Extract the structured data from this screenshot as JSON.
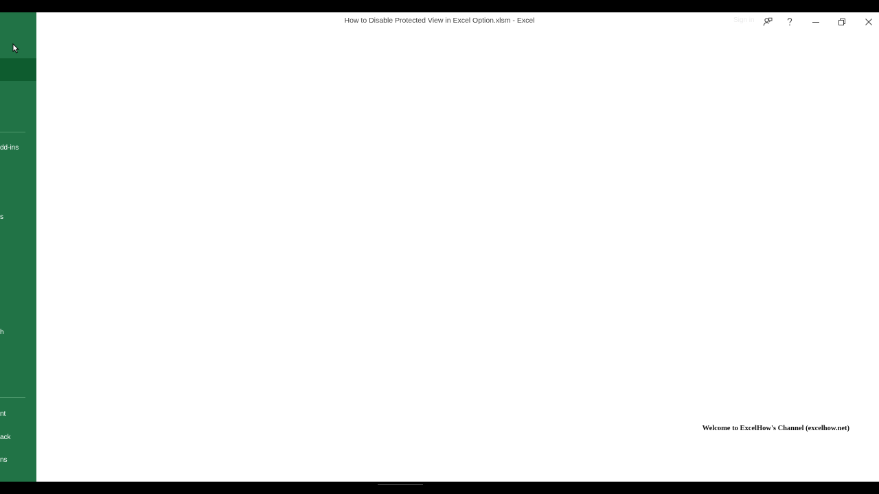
{
  "window": {
    "title": "How to Disable Protected View in Excel Option.xlsm  -  Excel",
    "sign_in": "Sign in"
  },
  "sidebar": {
    "items": [
      {
        "label": "dd-ins"
      },
      {
        "label": "s"
      },
      {
        "label": "h"
      },
      {
        "label": "nt"
      },
      {
        "label": "ack"
      },
      {
        "label": "ns"
      }
    ]
  },
  "titlebar_buttons": {
    "feedback": "feedback-icon",
    "help": "help-icon",
    "minimize": "minimize-icon",
    "restore": "restore-icon",
    "close": "close-icon"
  },
  "watermark": {
    "text": "Welcome to ExcelHow's  Channel (excelhow.net)"
  },
  "colors": {
    "sidebar_green": "#217346",
    "sidebar_selected": "#0e5c2f",
    "background": "#ffffff",
    "frame": "#000000"
  }
}
